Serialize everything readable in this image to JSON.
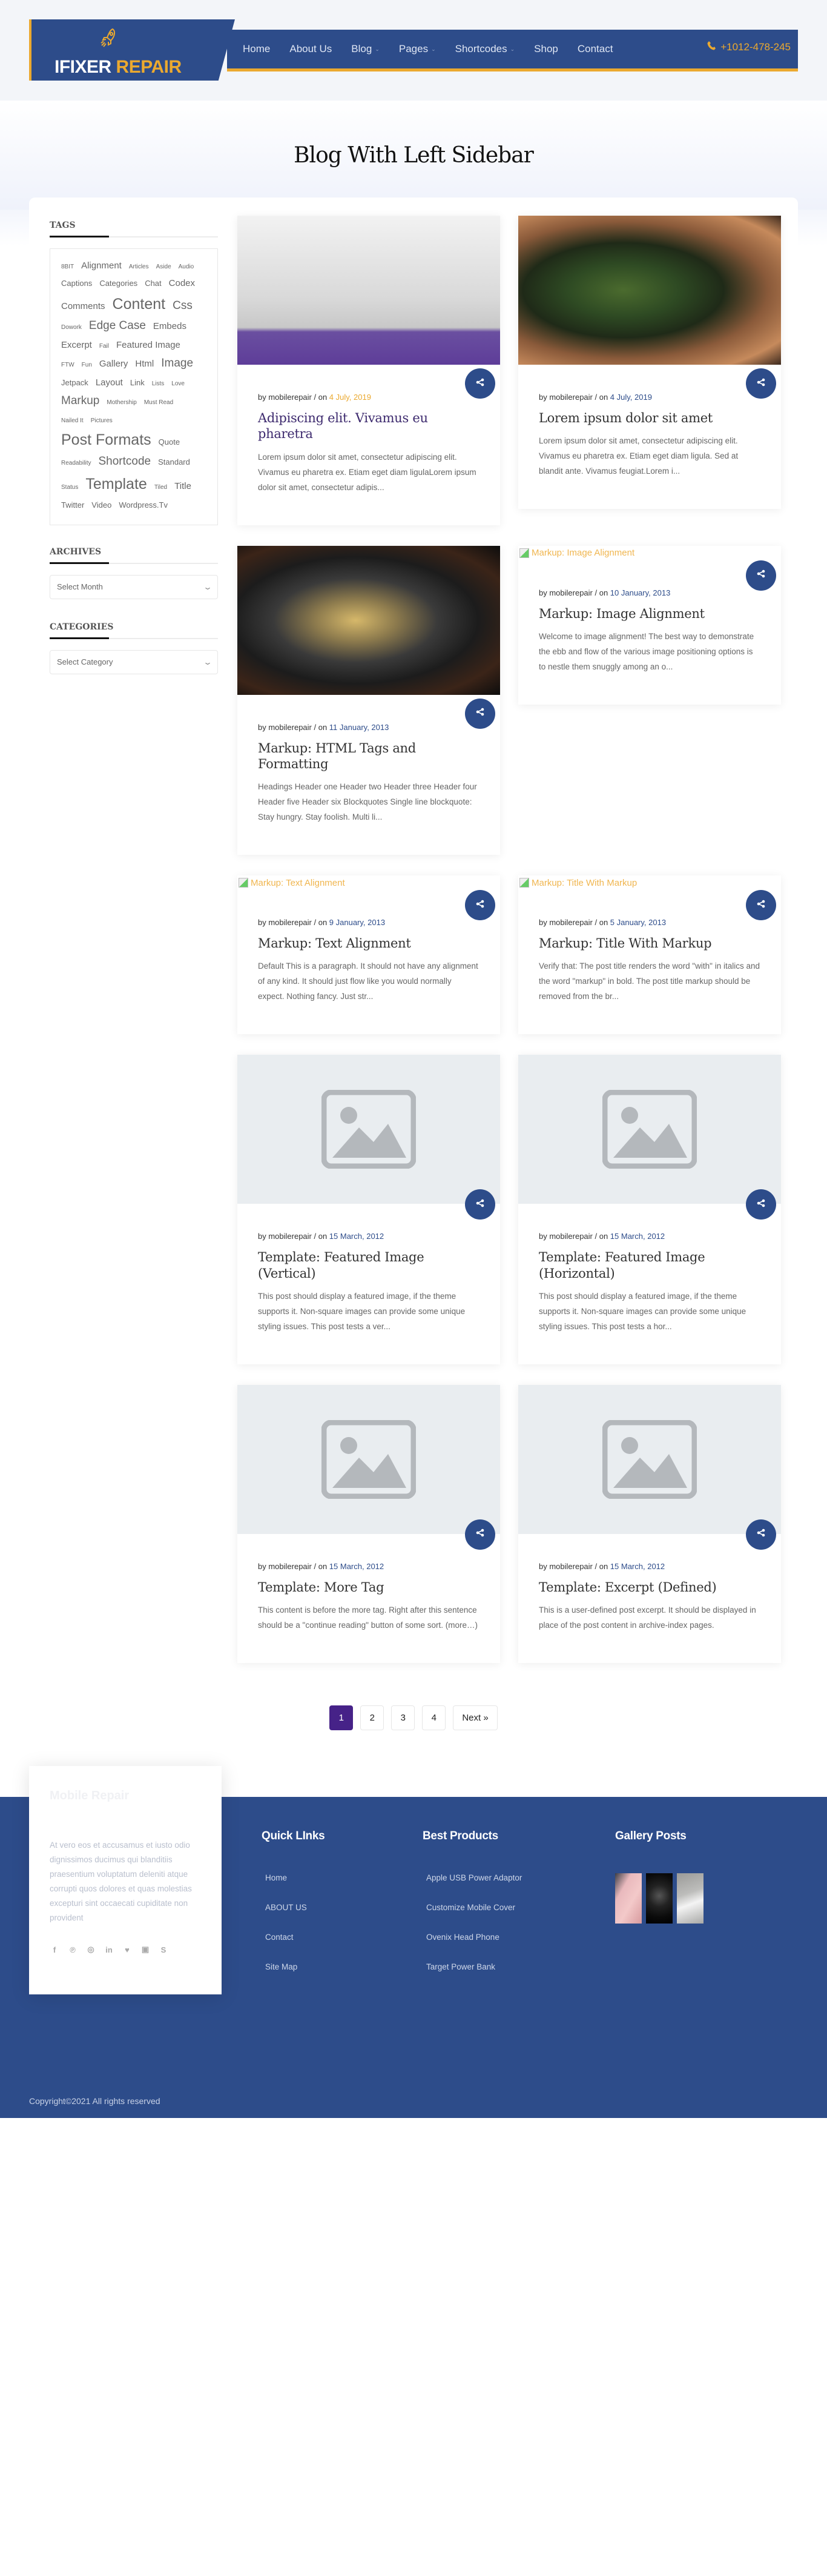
{
  "brand": {
    "name_part1": "IFIXER",
    "name_part2": "REPAIR",
    "accent_color": "#eba92f",
    "primary_color": "#2d4c8a"
  },
  "nav": {
    "items": [
      {
        "label": "Home",
        "dropdown": false
      },
      {
        "label": "About Us",
        "dropdown": false
      },
      {
        "label": "Blog",
        "dropdown": true
      },
      {
        "label": "Pages",
        "dropdown": true
      },
      {
        "label": "Shortcodes",
        "dropdown": true
      },
      {
        "label": "Shop",
        "dropdown": false
      },
      {
        "label": "Contact",
        "dropdown": false
      }
    ],
    "phone": "+1012-478-245"
  },
  "hero": {
    "title": "Blog With Left Sidebar"
  },
  "sidebar": {
    "tags_title": "TAGS",
    "tags": [
      {
        "label": "8BIT",
        "size": 1
      },
      {
        "label": "Alignment",
        "size": 3
      },
      {
        "label": "Articles",
        "size": 1
      },
      {
        "label": "Aside",
        "size": 1
      },
      {
        "label": "Audio",
        "size": 1
      },
      {
        "label": "Captions",
        "size": 2
      },
      {
        "label": "Categories",
        "size": 2
      },
      {
        "label": "Chat",
        "size": 2
      },
      {
        "label": "Codex",
        "size": 3
      },
      {
        "label": "Comments",
        "size": 3
      },
      {
        "label": "Content",
        "size": 5
      },
      {
        "label": "Css",
        "size": 4
      },
      {
        "label": "Dowork",
        "size": 1
      },
      {
        "label": "Edge Case",
        "size": 4
      },
      {
        "label": "Embeds",
        "size": 3
      },
      {
        "label": "Excerpt",
        "size": 3
      },
      {
        "label": "Fail",
        "size": 1
      },
      {
        "label": "Featured Image",
        "size": 3
      },
      {
        "label": "FTW",
        "size": 1
      },
      {
        "label": "Fun",
        "size": 1
      },
      {
        "label": "Gallery",
        "size": 3
      },
      {
        "label": "Html",
        "size": 3
      },
      {
        "label": "Image",
        "size": 4
      },
      {
        "label": "Jetpack",
        "size": 2
      },
      {
        "label": "Layout",
        "size": 3
      },
      {
        "label": "Link",
        "size": 2
      },
      {
        "label": "Lists",
        "size": 1
      },
      {
        "label": "Love",
        "size": 1
      },
      {
        "label": "Markup",
        "size": 4
      },
      {
        "label": "Mothership",
        "size": 1
      },
      {
        "label": "Must Read",
        "size": 1
      },
      {
        "label": "Nailed It",
        "size": 1
      },
      {
        "label": "Pictures",
        "size": 1
      },
      {
        "label": "Post Formats",
        "size": 5
      },
      {
        "label": "Quote",
        "size": 2
      },
      {
        "label": "Readability",
        "size": 1
      },
      {
        "label": "Shortcode",
        "size": 4
      },
      {
        "label": "Standard",
        "size": 2
      },
      {
        "label": "Status",
        "size": 1
      },
      {
        "label": "Template",
        "size": 5
      },
      {
        "label": "Tiled",
        "size": 1
      },
      {
        "label": "Title",
        "size": 3
      },
      {
        "label": "Twitter",
        "size": 2
      },
      {
        "label": "Video",
        "size": 2
      },
      {
        "label": "Wordpress.Tv",
        "size": 2
      }
    ],
    "archives_title": "ARCHIVES",
    "archives_select": "Select Month",
    "categories_title": "CATEGORIES",
    "categories_select": "Select Category"
  },
  "posts": [
    {
      "author_prefix": "by mobilerepair / on",
      "date": "4 July, 2019",
      "date_color": "orange",
      "title": "Adipiscing elit. Vivamus eu pharetra",
      "title_color": "purple",
      "excerpt": "Lorem ipsum dolor sit amet, consectetur adipiscing elit. Vivamus eu pharetra ex. Etiam eget diam ligulaLorem ipsum dolor sit amet, consectetur adipis...",
      "image": "phone-photo",
      "image_alt": ""
    },
    {
      "author_prefix": "by mobilerepair / on",
      "date": "4 July, 2019",
      "date_color": "blue",
      "title": "Lorem ipsum dolor sit amet",
      "title_color": "dark",
      "excerpt": "Lorem ipsum dolor sit amet, consectetur adipiscing elit. Vivamus eu pharetra ex. Etiam eget diam ligula. Sed at blandit ante. Vivamus feugiat.Lorem i...",
      "image": "circuit-photo",
      "image_alt": ""
    },
    {
      "author_prefix": "by mobilerepair / on",
      "date": "11 January, 2013",
      "date_color": "blue",
      "title": "Markup: HTML Tags and Formatting",
      "title_color": "dark",
      "excerpt": "Headings Header one Header two Header three Header four Header five Header six Blockquotes Single line blockquote: Stay hungry. Stay foolish. Multi li...",
      "image": "screen-photo",
      "image_alt": ""
    },
    {
      "author_prefix": "by mobilerepair / on",
      "date": "10 January, 2013",
      "date_color": "blue",
      "title": "Markup: Image Alignment",
      "title_color": "dark",
      "excerpt": "Welcome to image alignment! The best way to demonstrate the ebb and flow of the various image positioning options is to nestle them snuggly among an o...",
      "image": "broken",
      "image_alt": "Markup: Image Alignment"
    },
    {
      "author_prefix": "by mobilerepair / on",
      "date": "9 January, 2013",
      "date_color": "blue",
      "title": "Markup: Text Alignment",
      "title_color": "dark",
      "excerpt": "Default This is a paragraph. It should not have any alignment of any kind. It should just flow like you would normally expect. Nothing fancy. Just str...",
      "image": "broken",
      "image_alt": "Markup: Text Alignment"
    },
    {
      "author_prefix": "by mobilerepair / on",
      "date": "5 January, 2013",
      "date_color": "blue",
      "title": "Markup: Title With Markup",
      "title_color": "dark",
      "excerpt": "Verify that: The post title renders the word \"with\" in italics and the word \"markup\" in bold. The post title markup should be removed from the br...",
      "image": "broken",
      "image_alt": "Markup: Title With Markup"
    },
    {
      "author_prefix": "by mobilerepair / on",
      "date": "15 March, 2012",
      "date_color": "blue",
      "title": "Template: Featured Image (Vertical)",
      "title_color": "dark",
      "excerpt": "This post should display a featured image, if the theme supports it. Non-square images can provide some unique styling issues. This post tests a ver...",
      "image": "placeholder",
      "image_alt": ""
    },
    {
      "author_prefix": "by mobilerepair / on",
      "date": "15 March, 2012",
      "date_color": "blue",
      "title": "Template: Featured Image (Horizontal)",
      "title_color": "dark",
      "excerpt": "This post should display a featured image, if the theme supports it. Non-square images can provide some unique styling issues. This post tests a hor...",
      "image": "placeholder",
      "image_alt": ""
    },
    {
      "author_prefix": "by mobilerepair / on",
      "date": "15 March, 2012",
      "date_color": "blue",
      "title": "Template: More Tag",
      "title_color": "dark",
      "excerpt": "This content is before the more tag. Right after this sentence should be a \"continue reading\" button of some sort. (more…)",
      "image": "placeholder",
      "image_alt": ""
    },
    {
      "author_prefix": "by mobilerepair / on",
      "date": "15 March, 2012",
      "date_color": "blue",
      "title": "Template: Excerpt (Defined)",
      "title_color": "dark",
      "excerpt": "This is a user-defined post excerpt. It should be displayed in place of the post content in archive-index pages.",
      "image": "placeholder",
      "image_alt": ""
    }
  ],
  "pagination": {
    "pages": [
      "1",
      "2",
      "3",
      "4"
    ],
    "current": "1",
    "next_label": "Next »"
  },
  "footer": {
    "about_title": "Mobile Repair",
    "about_text": "At vero eos et accusamus et iusto odio dignissimos ducimus qui blanditiis praesentium voluptatum deleniti atque corrupti quos dolores et quas molestias excepturi sint occaecati cupiditate non provident",
    "socials": [
      "facebook",
      "pinterest",
      "instagram",
      "linkedin",
      "twitter",
      "youtube",
      "skype"
    ],
    "quick_links_title": "Quick LInks",
    "quick_links": [
      "Home",
      "ABOUT US",
      "Contact",
      "Site Map"
    ],
    "products_title": "Best Products",
    "products": [
      "Apple USB Power Adaptor",
      "Customize Mobile Cover",
      "Ovenix Head Phone",
      "Target Power Bank"
    ],
    "gallery_title": "Gallery Posts",
    "gallery": [
      "pink-phone-case",
      "headphones",
      "power-adapter"
    ],
    "copyright": "Copyright©2021 All rights reserved"
  }
}
